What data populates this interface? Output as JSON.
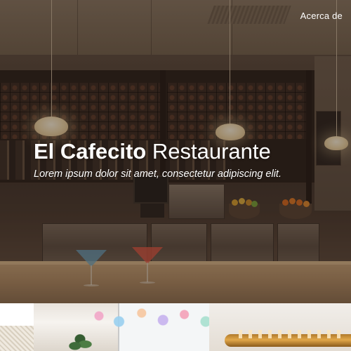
{
  "nav": {
    "about_label": "Acerca de"
  },
  "hero": {
    "title_bold": "El Cafecito",
    "title_light": "Restaurante",
    "subtitle": "Lorem ipsum dolor sit amet, consectetur adipiscing elit."
  },
  "colors": {
    "text": "#ffffff",
    "overlay": "#1c120c",
    "bar_wood": "#c9a57a"
  },
  "images": {
    "hero": "restaurant-bar-photo",
    "next_section": "restaurant-interior-photos"
  }
}
